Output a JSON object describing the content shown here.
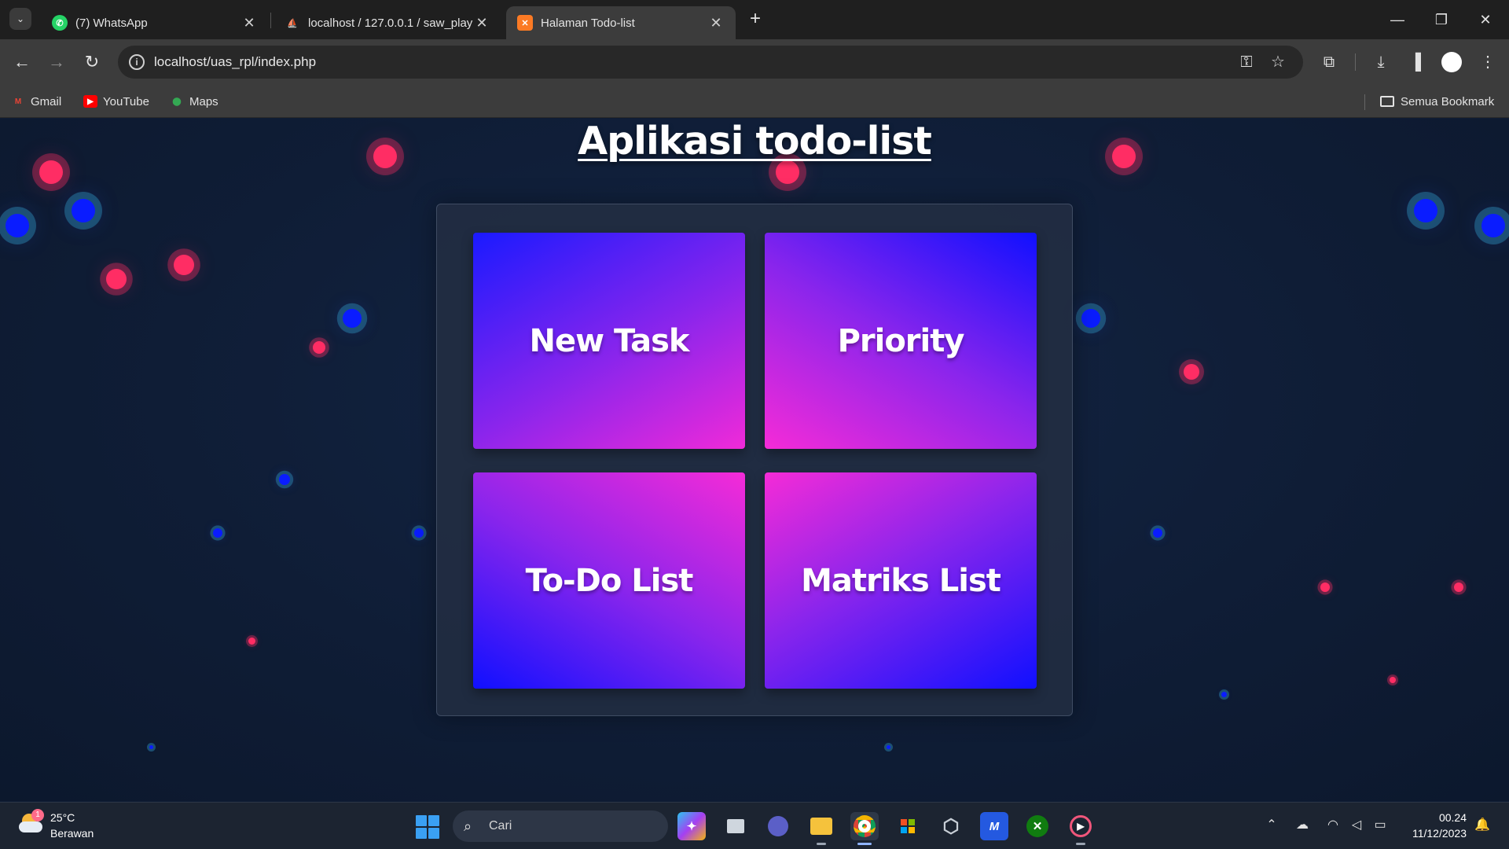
{
  "browser": {
    "tabs": [
      {
        "title": "(7) WhatsApp",
        "active": false
      },
      {
        "title": "localhost / 127.0.0.1 / saw_play",
        "active": false
      },
      {
        "title": "Halaman Todo-list",
        "active": true
      }
    ],
    "address": "localhost/uas_rpl/index.php",
    "bookmarks": [
      "Gmail",
      "YouTube",
      "Maps"
    ],
    "all_bookmarks": "Semua Bookmark"
  },
  "page": {
    "title": "Aplikasi todo-list",
    "menu": [
      {
        "label": "New Task"
      },
      {
        "label": "Priority"
      },
      {
        "label": "To-Do List"
      },
      {
        "label": "Matriks List"
      }
    ]
  },
  "taskbar": {
    "weather_temp": "25°C",
    "weather_desc": "Berawan",
    "weather_badge": "1",
    "search_label": "Cari",
    "time": "00.24",
    "date": "11/12/2023"
  },
  "colors": {
    "accent_red": "#ff2d64",
    "accent_blue": "#0a1cff",
    "card_pink": "#f52bd7",
    "card_blue": "#1010ff"
  }
}
